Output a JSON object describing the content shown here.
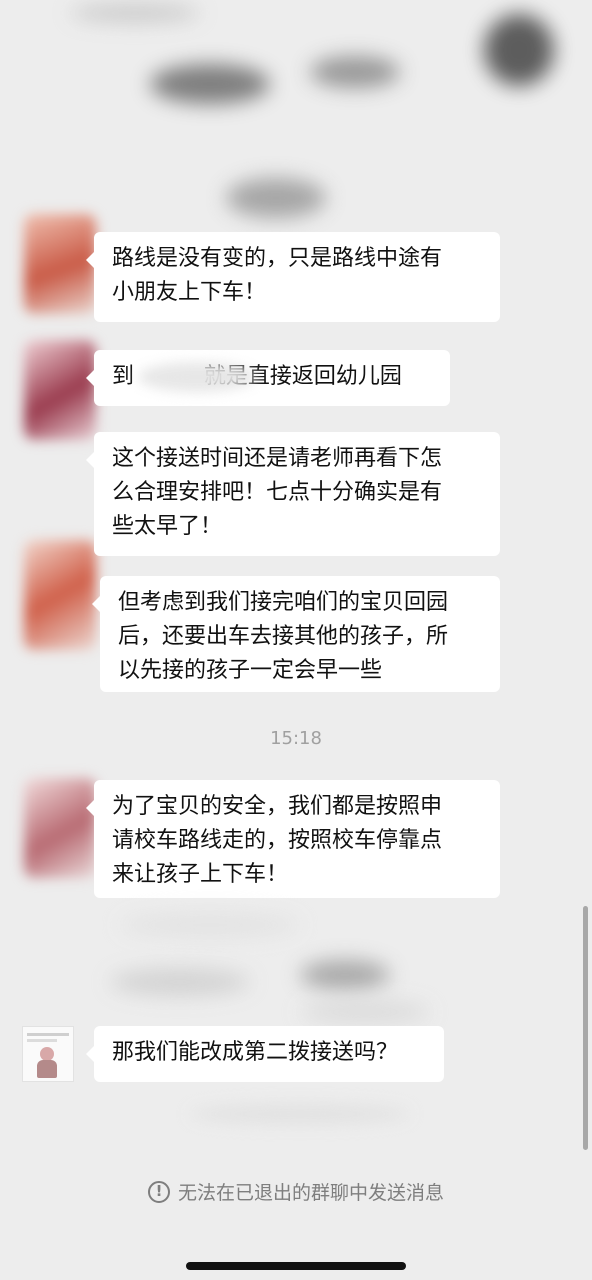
{
  "chat": {
    "messages": [
      {
        "text": "路线是没有变的，只是路线中途有\n小朋友上下车！"
      },
      {
        "text": "到          就是直接返回幼儿园"
      },
      {
        "text": "这个接送时间还是请老师再看下怎\n么合理安排吧！七点十分确实是有\n些太早了！"
      },
      {
        "text": "但考虑到我们接完咱们的宝贝回园\n后，还要出车去接其他的孩子，所\n以先接的孩子一定会早一些"
      },
      {
        "text": "为了宝贝的安全，我们都是按照申\n请校车路线走的，按照校车停靠点\n来让孩子上下车！"
      },
      {
        "text": "那我们能改成第二拨接送吗？"
      }
    ],
    "timestamp": "15:18",
    "notice_icon": "!",
    "notice": "无法在已退出的群聊中发送消息"
  },
  "colors": {
    "background": "#ededed",
    "bubble": "#ffffff",
    "text": "#111111",
    "meta_text": "#a0a0a0"
  }
}
